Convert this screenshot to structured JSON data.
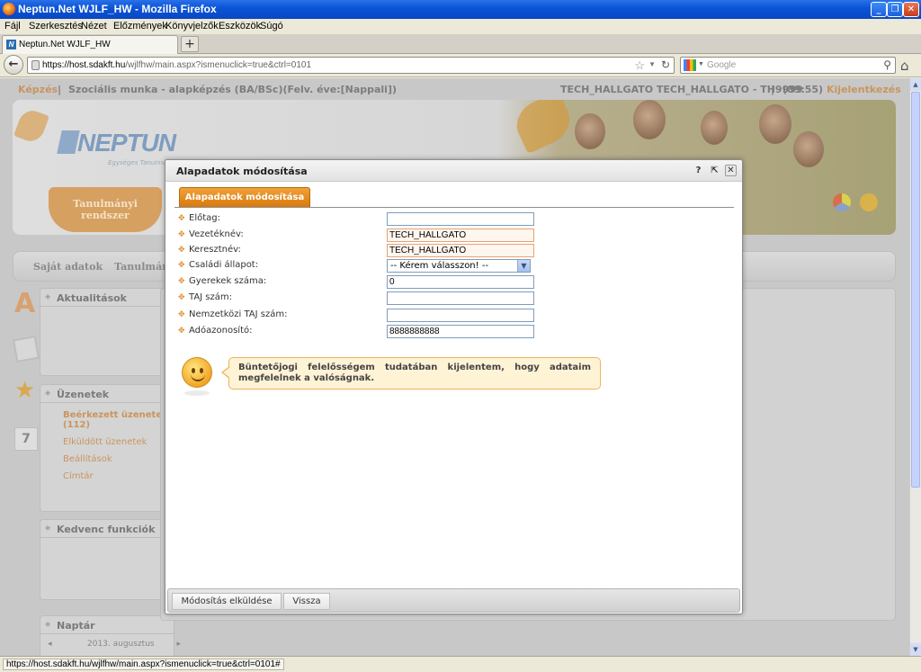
{
  "window": {
    "title": "Neptun.Net WJLF_HW - Mozilla Firefox",
    "minimize": "_",
    "maximize": "❐",
    "close": "✕"
  },
  "menu": [
    "Fájl",
    "Szerkesztés",
    "Nézet",
    "Előzmények",
    "Könyvjelzők",
    "Eszközök",
    "Súgó"
  ],
  "tab": {
    "favicon": "N",
    "label": "Neptun.Net WJLF_HW",
    "new_tab": "+"
  },
  "nav": {
    "back": "←",
    "url_host": "https://host.sdakft.hu",
    "url_path": "/wjlfhw/main.aspx?ismenuclick=true&ctrl=0101",
    "search_placeholder": "Google",
    "star": "☆",
    "dropdown": "▼",
    "reload": "↻",
    "magnifier": "⚲",
    "home": "⌂"
  },
  "status_text": "https://host.sdakft.hu/wjlfhw/main.aspx?ismenuclick=true&ctrl=0101#",
  "scroll": {
    "up": "▲",
    "down": "▼"
  },
  "background": {
    "training_link": "Képzés",
    "separator": "|",
    "training": "Szociális munka - alapképzés (BA/BSc)(Felv. éve:[Nappali])",
    "user": "TECH_HALLGATO TECH_HALLGATO - TH9999",
    "time": "(09:55)",
    "logout": "Kijelentkezés",
    "logo": "NEPTUN",
    "logo_sub": "Egységes Tanulmányi Rendszer",
    "system_tab": "Tanulmányi rendszer",
    "nav_items": [
      "Saját adatok",
      "Tanulmány"
    ],
    "news_title": "Aktualitások",
    "messages_title": "Üzenetek",
    "messages_items": [
      "Beérkezett üzenetek (112)",
      "Elküldött üzenetek",
      "Beállítások",
      "Címtár"
    ],
    "favorites_title": "Kedvenc funkciók",
    "calendar_title": "Naptár",
    "calendar_month": "2013. augusztus",
    "calendar_prev": "◂",
    "calendar_next": "▸",
    "sideicon_a": "A",
    "sideicon_star": "★",
    "sideicon_cal": "7"
  },
  "modal": {
    "title": "Alapadatok módosítása",
    "help": "?",
    "popout": "⇱",
    "close": "✕",
    "tab_label": "Alapadatok módosítása",
    "fields": [
      {
        "label": "Előtag:",
        "value": ""
      },
      {
        "label": "Vezetéknév:",
        "value": "TECH_HALLGATO"
      },
      {
        "label": "Keresztnév:",
        "value": "TECH_HALLGATO"
      },
      {
        "label": "Családi állapot:",
        "value": "-- Kérem válasszon! --"
      },
      {
        "label": "Gyerekek száma:",
        "value": "0"
      },
      {
        "label": "TAJ szám:",
        "value": ""
      },
      {
        "label": "Nemzetközi TAJ szám:",
        "value": ""
      },
      {
        "label": "Adóazonosító:",
        "value": "8888888888"
      }
    ],
    "bullet": "✥",
    "select_arrow": "▼",
    "declaration": "Büntetőjogi felelősségem tudatában kijelentem, hogy adataim megfelelnek a valóságnak.",
    "submit_button": "Módosítás elküldése",
    "back_button": "Vissza"
  },
  "colors": {
    "accent_orange": "#E18A2D",
    "titlebar_blue": "#0A55D8"
  }
}
